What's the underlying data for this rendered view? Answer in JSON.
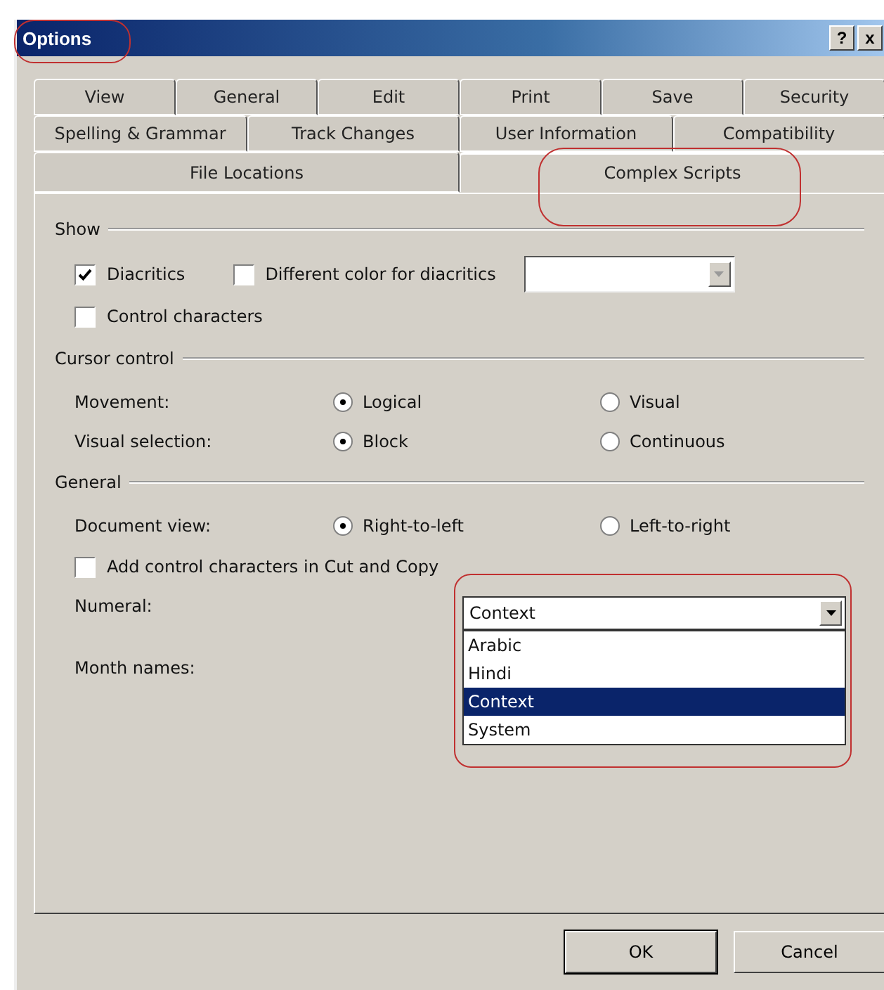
{
  "window": {
    "title": "Options",
    "highlighted": true,
    "title_buttons": [
      "?",
      "x"
    ]
  },
  "tab_rows": [
    [
      {
        "label": "View",
        "selected": false,
        "highlighted": false
      },
      {
        "label": "General",
        "selected": false,
        "highlighted": false
      },
      {
        "label": "Edit",
        "selected": false,
        "highlighted": false
      },
      {
        "label": "Print",
        "selected": false,
        "highlighted": false
      },
      {
        "label": "Save",
        "selected": false,
        "highlighted": false
      },
      {
        "label": "Security",
        "selected": false,
        "highlighted": false
      }
    ],
    [
      {
        "label": "Spelling & Grammar",
        "selected": false,
        "highlighted": false
      },
      {
        "label": "Track Changes",
        "selected": false,
        "highlighted": false
      },
      {
        "label": "User Information",
        "selected": false,
        "highlighted": false
      },
      {
        "label": "Compatibility",
        "selected": false,
        "highlighted": false
      }
    ],
    [
      {
        "label": "File Locations",
        "selected": false,
        "highlighted": false
      },
      {
        "label": "Complex Scripts",
        "selected": true,
        "highlighted": true
      }
    ]
  ],
  "sections": [
    {
      "title": "Show",
      "rows": [
        {
          "kind": "checkbox_row",
          "items": [
            {
              "label": "Diacritics",
              "checked": true
            },
            {
              "label": "Different color for diacritics",
              "checked": false
            }
          ],
          "color_dropdown": true
        },
        {
          "kind": "checkbox_row",
          "items": [
            {
              "label": "Control characters",
              "checked": false
            }
          ]
        }
      ]
    },
    {
      "title": "Cursor control",
      "rows": [
        {
          "kind": "radio_row",
          "label": "Movement:",
          "options": [
            {
              "label": "Logical",
              "selected": true
            },
            {
              "label": "Visual",
              "selected": false
            }
          ]
        },
        {
          "kind": "radio_row",
          "label": "Visual selection:",
          "options": [
            {
              "label": "Block",
              "selected": true
            },
            {
              "label": "Continuous",
              "selected": false
            }
          ]
        }
      ]
    },
    {
      "title": "General",
      "rows": [
        {
          "kind": "radio_row",
          "label": "Document view:",
          "options": [
            {
              "label": "Right-to-left",
              "selected": true
            },
            {
              "label": "Left-to-right",
              "selected": false
            }
          ]
        },
        {
          "kind": "checkbox_row",
          "items": [
            {
              "label": "Add control characters in Cut and Copy",
              "checked": false
            }
          ]
        },
        {
          "kind": "dropdown_row",
          "label": "Numeral:",
          "value": "Context",
          "expanded": true,
          "highlighted": true,
          "options": [
            {
              "label": "Arabic",
              "selected": false
            },
            {
              "label": "Hindi",
              "selected": false
            },
            {
              "label": "Context",
              "selected": true
            },
            {
              "label": "System",
              "selected": false
            }
          ]
        },
        {
          "kind": "label_row",
          "label": "Month names:"
        }
      ]
    }
  ],
  "buttons": [
    "OK",
    "Cancel"
  ]
}
